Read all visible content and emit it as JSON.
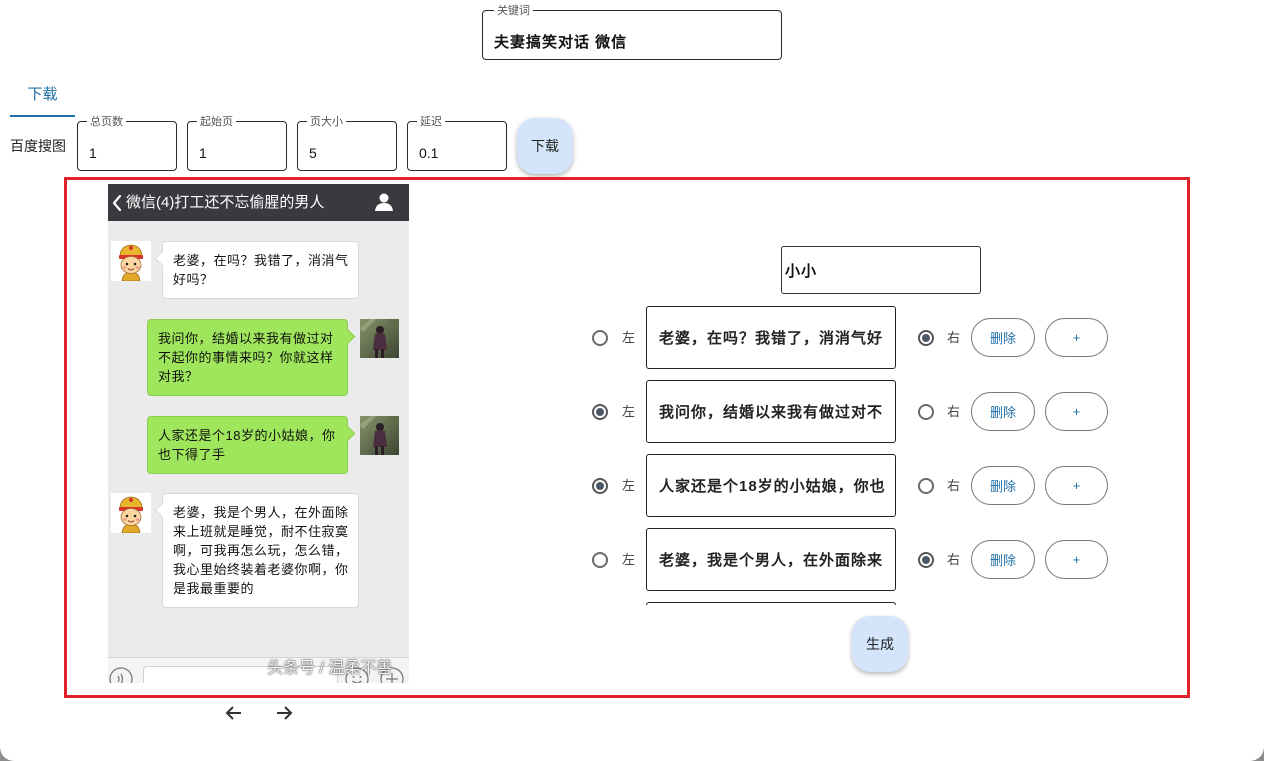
{
  "keyword": {
    "label": "关键词",
    "value": "夫妻搞笑对话 微信"
  },
  "tabs": [
    {
      "label": "下载",
      "active": true
    }
  ],
  "search_source": "百度搜图",
  "params": {
    "total_pages": {
      "label": "总页数",
      "value": "1"
    },
    "start_page": {
      "label": "起始页",
      "value": "1"
    },
    "page_size": {
      "label": "页大小",
      "value": "5"
    },
    "delay": {
      "label": "延迟",
      "value": "0.1"
    }
  },
  "download_button": "下载",
  "preview": {
    "back_icon": "chevron-left-icon",
    "title": "微信(4)打工还不忘偷腥的男人",
    "contact_icon": "person-icon",
    "messages": [
      {
        "outgoing": false,
        "avatar_icon": "cartoon-avatar-icon",
        "lines": [
          "老婆，在吗？我错了，消消气",
          "好吗？"
        ]
      },
      {
        "outgoing": true,
        "avatar_icon": "photo-avatar-icon",
        "lines": [
          "我问你，结婚以来我有做过对",
          "不起你的事情来吗？你就这样",
          "对我？"
        ]
      },
      {
        "outgoing": true,
        "avatar_icon": "photo-avatar-icon",
        "lines": [
          "人家还是个18岁的小姑娘，你",
          "也下得了手"
        ]
      },
      {
        "outgoing": false,
        "avatar_icon": "cartoon-avatar-icon",
        "lines": [
          "老婆，我是个男人，在外面除",
          "来上班就是睡觉，耐不住寂寞",
          "啊，可我再怎么玩，怎么错，",
          "我心里始终装着老婆你啊，你",
          "是我最重要的"
        ]
      }
    ],
    "input_bar_icons": [
      "voice-icon",
      "emoji-icon",
      "plus-icon"
    ],
    "watermark": "头条号 / 温柔不善"
  },
  "image_nav": {
    "prev_icon": "arrow-left-icon",
    "next_icon": "arrow-right-icon"
  },
  "editor": {
    "name_value": "小小",
    "left_label": "左",
    "right_label": "右",
    "delete_label": "删除",
    "add_label": "+",
    "rows": [
      {
        "text": "老婆，在吗？我错了，消消气好",
        "left_selected": false,
        "right_selected": true
      },
      {
        "text": "我问你，结婚以来我有做过对不",
        "left_selected": true,
        "right_selected": false
      },
      {
        "text": "人家还是个18岁的小姑娘，你也",
        "left_selected": true,
        "right_selected": false
      },
      {
        "text": "老婆，我是个男人，在外面除来",
        "left_selected": false,
        "right_selected": true
      }
    ]
  },
  "generate_button": "生成",
  "colors": {
    "accent": "#1f6fa8",
    "highlight_border": "#e1222b",
    "fab_bg": "#d4e5fb",
    "wechat_header": "#393a3f",
    "chat_bg": "#ebebeb",
    "bubble_green": "#9fe65c"
  }
}
